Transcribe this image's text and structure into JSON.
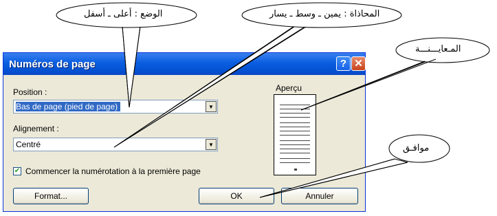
{
  "callouts": {
    "position_note": "الوضع : أعلى ـ أسفل",
    "alignment_note": "المحاذاة : يمين ـ وسط ـ يسار",
    "preview_note": "المـعايـــنـــة",
    "ok_note": "موافـق"
  },
  "dialog": {
    "title": "Numéros de page",
    "help_symbol": "?",
    "close_symbol": "✕",
    "position_label": "Position :",
    "position_value": "Bas de page (pied de page)",
    "alignment_label": "Alignement :",
    "alignment_value": "Centré",
    "checkbox_label": "Commencer la numérotation à la première page",
    "checkbox_checked": true,
    "preview_label": "Aperçu",
    "format_button": "Format...",
    "ok_button": "OK",
    "cancel_button": "Annuler"
  },
  "icons": {
    "dropdown": "dropdown-arrow-icon",
    "check": "check-icon",
    "help": "help-icon",
    "close": "close-icon"
  }
}
